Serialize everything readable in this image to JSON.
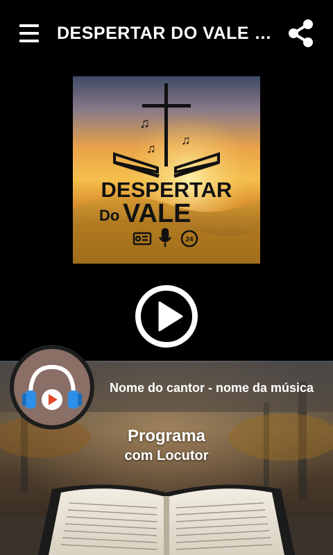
{
  "appbar": {
    "title": "DESPERTAR DO VALE R...",
    "menu_icon": "hamburger-menu-icon",
    "share_icon": "share-icon"
  },
  "logo": {
    "line1": "DESPERTAR",
    "line2_small": "Do",
    "line2_big": "VALE",
    "badge_24": "24"
  },
  "player": {
    "play_icon": "play-circle-icon",
    "now_playing": "Nome do cantor - nome da música",
    "program": "Programa",
    "presenter": "com Locutor",
    "avatar_icon": "headphones-play-icon"
  },
  "colors": {
    "background": "#000000",
    "text": "#ffffff",
    "avatar_bg": "#8a6f66",
    "headphone_blue": "#2e8fe8",
    "play_red": "#e8462a"
  }
}
